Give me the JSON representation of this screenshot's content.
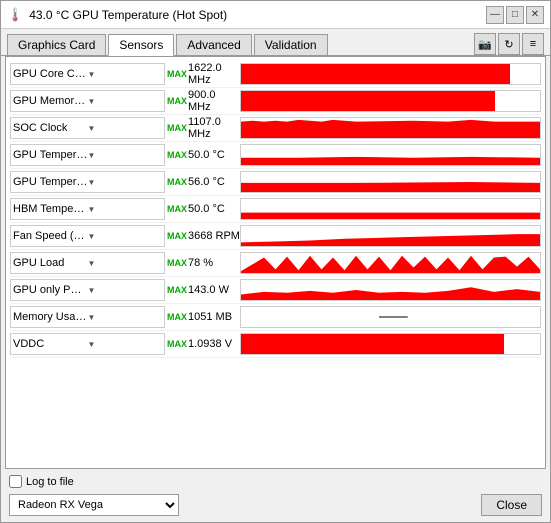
{
  "window": {
    "title": "43.0 °C GPU Temperature (Hot Spot)",
    "title_icon": "🌡️"
  },
  "title_controls": {
    "minimize": "—",
    "maximize": "□",
    "close": "✕"
  },
  "tabs": [
    {
      "label": "Graphics Card",
      "active": false
    },
    {
      "label": "Sensors",
      "active": true
    },
    {
      "label": "Advanced",
      "active": false
    },
    {
      "label": "Validation",
      "active": false
    }
  ],
  "toolbar_icons": [
    "📷",
    "↻",
    "≡"
  ],
  "sensors": [
    {
      "name": "GPU Core Clock",
      "max_label": "MAX",
      "value": "1622.0 MHz",
      "graph_type": "solid",
      "fill_pct": 90
    },
    {
      "name": "GPU Memory Clock",
      "max_label": "MAX",
      "value": "900.0 MHz",
      "graph_type": "solid",
      "fill_pct": 85
    },
    {
      "name": "SOC Clock",
      "max_label": "MAX",
      "value": "1107.0 MHz",
      "graph_type": "spike",
      "fill_pct": 75
    },
    {
      "name": "GPU Temperature",
      "max_label": "MAX",
      "value": "50.0 °C",
      "graph_type": "line",
      "fill_pct": 40
    },
    {
      "name": "GPU Temperature (Hot Spot)",
      "max_label": "MAX",
      "value": "56.0 °C",
      "graph_type": "line",
      "fill_pct": 45
    },
    {
      "name": "HBM Temperature",
      "max_label": "MAX",
      "value": "50.0 °C",
      "graph_type": "line",
      "fill_pct": 38
    },
    {
      "name": "Fan Speed (RPM)",
      "max_label": "MAX",
      "value": "3668 RPM",
      "graph_type": "wave",
      "fill_pct": 55
    },
    {
      "name": "GPU Load",
      "max_label": "MAX",
      "value": "78 %",
      "graph_type": "spiky",
      "fill_pct": 65
    },
    {
      "name": "GPU only Power Draw",
      "max_label": "MAX",
      "value": "143.0 W",
      "graph_type": "spiky2",
      "fill_pct": 60
    },
    {
      "name": "Memory Usage (Dedicated)",
      "max_label": "MAX",
      "value": "1051 MB",
      "graph_type": "line2",
      "fill_pct": 20
    },
    {
      "name": "VDDC",
      "max_label": "MAX",
      "value": "1.0938 V",
      "graph_type": "solid",
      "fill_pct": 88
    }
  ],
  "footer": {
    "log_to_file_label": "Log to file",
    "gpu_select_value": "Radeon RX Vega",
    "close_label": "Close"
  }
}
